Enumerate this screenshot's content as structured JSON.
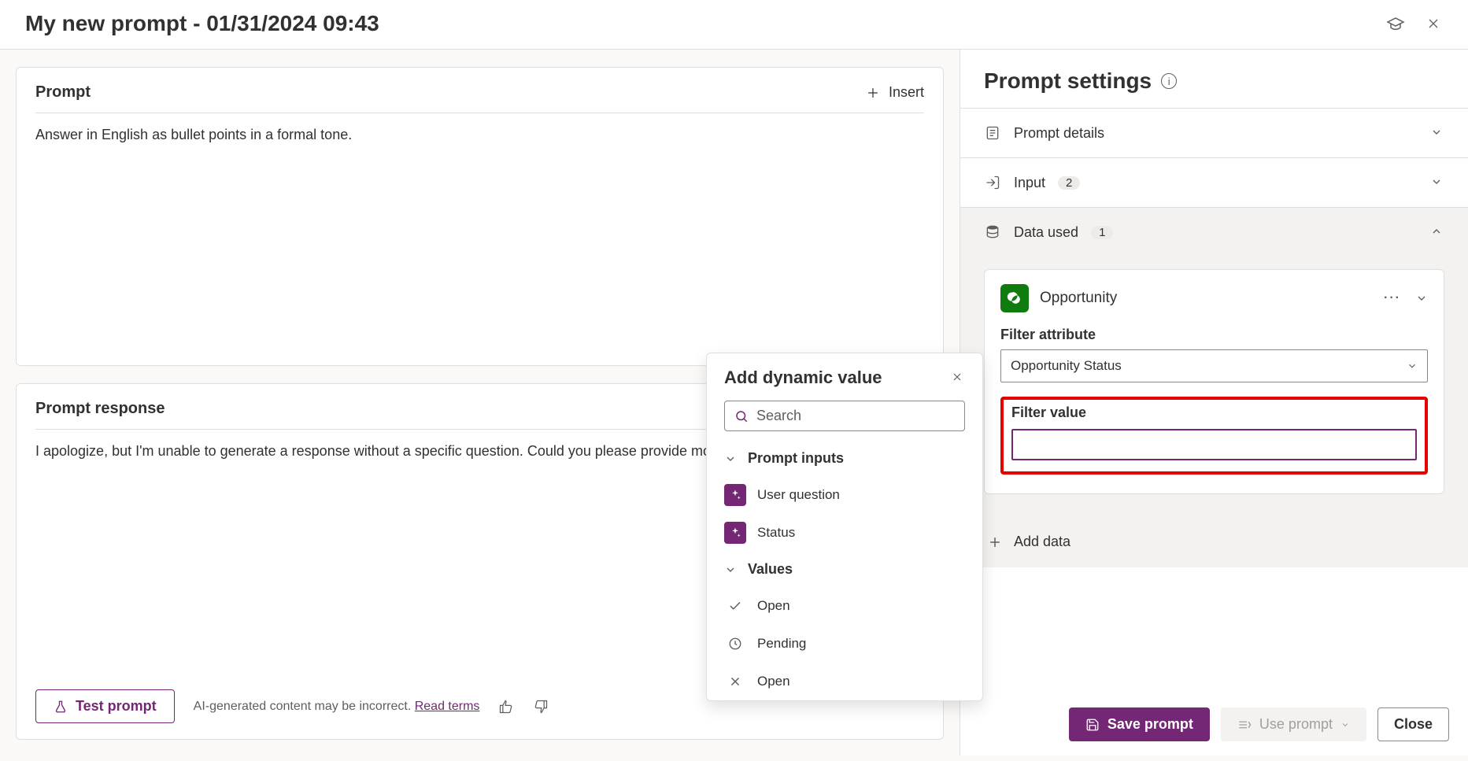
{
  "header": {
    "title": "My new prompt - 01/31/2024 09:43"
  },
  "prompt_card": {
    "title": "Prompt",
    "insert_label": "Insert",
    "body": "Answer in English as bullet points in a formal tone."
  },
  "response_card": {
    "title": "Prompt response",
    "body": "I apologize, but I'm unable to generate a response without a specific question. Could you please provide more de",
    "test_label": "Test prompt",
    "disclaimer": "AI-generated content may be incorrect.",
    "read_terms": "Read terms"
  },
  "dynamic_popup": {
    "title": "Add dynamic value",
    "search_placeholder": "Search",
    "group_inputs": "Prompt inputs",
    "item_user_question": "User question",
    "item_status": "Status",
    "group_values": "Values",
    "item_open1": "Open",
    "item_pending": "Pending",
    "item_open2": "Open"
  },
  "side": {
    "title": "Prompt settings",
    "sec_details": "Prompt details",
    "sec_input": "Input",
    "input_count": "2",
    "sec_data": "Data used",
    "data_count": "1",
    "entity": {
      "name": "Opportunity",
      "filter_attr_label": "Filter attribute",
      "filter_attr_value": "Opportunity Status",
      "filter_value_label": "Filter value",
      "filter_value": ""
    },
    "add_data": "Add data"
  },
  "footer": {
    "save": "Save prompt",
    "use": "Use prompt",
    "close": "Close"
  }
}
